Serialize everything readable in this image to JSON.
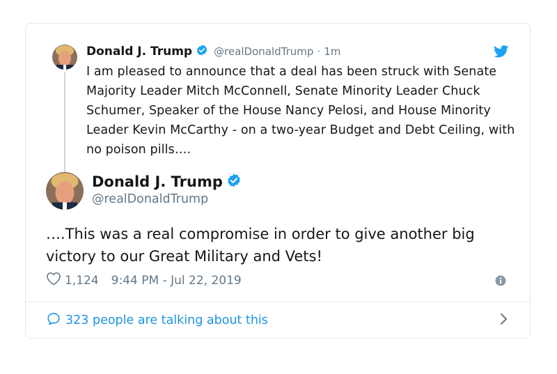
{
  "parent_tweet": {
    "name": "Donald J. Trump",
    "handle": "@realDonaldTrump",
    "separator": "·",
    "time": "1m",
    "text": "I am pleased to announce that a deal has been struck with Senate Majority Leader Mitch McConnell, Senate Minority Leader Chuck Schumer, Speaker of the House Nancy Pelosi, and House Minority Leader Kevin McCarthy - on a two-year Budget and Debt Ceiling, with no poison pills…."
  },
  "main_tweet": {
    "name": "Donald J. Trump",
    "handle": "@realDonaldTrump",
    "text": "….This was a real compromise in order to give another big victory to our Great Military and Vets!",
    "likes": "1,124",
    "timestamp": "9:44 PM - Jul 22, 2019"
  },
  "footer": {
    "talking_label": "323 people are talking about this"
  },
  "colors": {
    "twitter_blue": "#1da1f2",
    "link_blue": "#1b95e0",
    "muted_gray": "#657786",
    "border": "#e1e8ed"
  },
  "icons": [
    "twitter-bird-icon",
    "verified-badge-icon",
    "heart-icon",
    "info-icon",
    "speech-bubble-icon",
    "chevron-right-icon"
  ]
}
